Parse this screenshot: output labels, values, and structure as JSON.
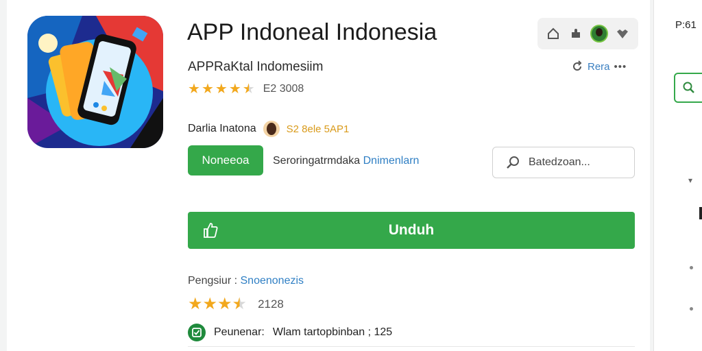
{
  "app": {
    "title": "APP Indoneal Indonesia",
    "subtitle": "APPRaKtal Indomesiim",
    "rating_stars": 4.5,
    "rating_count": "E2 3008"
  },
  "header_icons": [
    "home-icon",
    "puzzle-icon",
    "avatar",
    "heart-icon"
  ],
  "share": {
    "label": "Rera",
    "more": "•••"
  },
  "developer": {
    "name": "Darlia Inatona",
    "tag": "S2 8ele 5AP1"
  },
  "badge": {
    "label": "Noneeoa",
    "description": "Seroringatrmdaka",
    "link": "Dnimenlarn"
  },
  "search": {
    "placeholder": "Batedzoan..."
  },
  "download": {
    "label": "Unduh"
  },
  "meta": {
    "label": "Pengsiur :",
    "value": "Snoenonezis"
  },
  "rating2": {
    "stars": 3.5,
    "count": "2128"
  },
  "footer_row": {
    "label": "Peunenar:",
    "value": "Wlam tartopbinban ; 125"
  },
  "right_panel": {
    "text": "P:61"
  },
  "colors": {
    "accent_green": "#34a84a",
    "star": "#f2a81d",
    "link_blue": "#2f7fc4"
  }
}
